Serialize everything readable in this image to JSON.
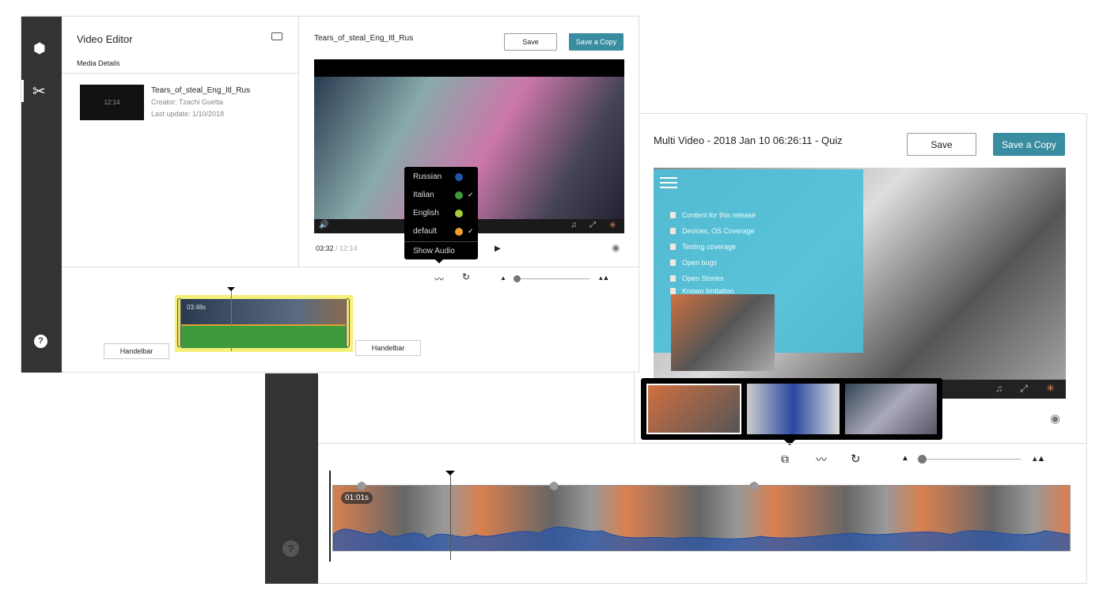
{
  "front": {
    "title": "Video Editor",
    "section": "Media Details",
    "media": {
      "name": "Tears_of_steal_Eng_Itl_Rus",
      "creator": "Creator: Tzachi Guetta",
      "updated": "Last update: 1/10/2018",
      "duration": "12:14"
    },
    "player_title": "Tears_of_steal_Eng_Itl_Rus",
    "save": "Save",
    "save_copy": "Save a Copy",
    "time_current": "03:32",
    "time_sep": "/",
    "time_total": "12:14",
    "audio_menu": [
      {
        "label": "Russian",
        "color": "#1e56a8",
        "checked": false
      },
      {
        "label": "Italian",
        "color": "#3d9a3d",
        "checked": true
      },
      {
        "label": "English",
        "color": "#a8cc3a",
        "checked": false
      },
      {
        "label": "default",
        "color": "#f0a030",
        "checked": true
      }
    ],
    "check": "✓",
    "show_audio": "Show Audio",
    "clip_time": "03:48s",
    "handle_left": "Handelbar",
    "handle_right": "Handelbar",
    "help": "?"
  },
  "back": {
    "title": "Multi Video - 2018 Jan 10 06:26:11 - Quiz",
    "save": "Save",
    "save_copy": "Save a Copy",
    "toc": [
      "Content for this release",
      "Devices, OS Coverage",
      "Testing coverage",
      "Open bugs",
      "Open Stories",
      "Known limitation"
    ],
    "clip_time": "01:01s",
    "help": "?"
  },
  "colors": {
    "accent": "#3a8da0",
    "sidebar": "#333333",
    "green_wave": "#3d9a3d",
    "blue_wave": "#2a56a8",
    "overlay": "#4cc0d8"
  }
}
